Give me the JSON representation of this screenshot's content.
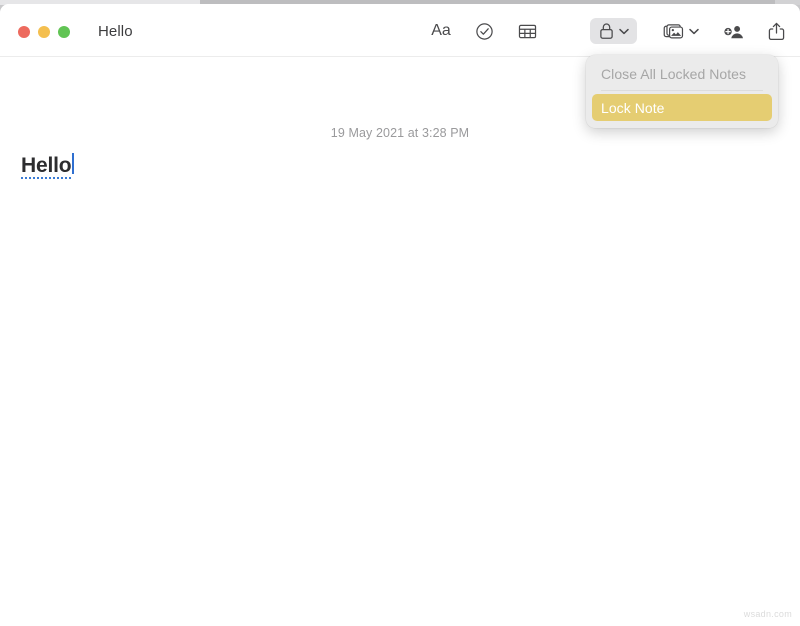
{
  "window": {
    "title": "Hello",
    "traffic_lights": [
      {
        "name": "close",
        "color": "#ed6a5e"
      },
      {
        "name": "minimize",
        "color": "#f4bf4f"
      },
      {
        "name": "maximize",
        "color": "#61c454"
      }
    ]
  },
  "toolbar": {
    "format_label": "Aa",
    "buttons": [
      {
        "icon": "format-aa-icon",
        "label": "Aa"
      },
      {
        "icon": "checklist-icon",
        "label": "Checklist"
      },
      {
        "icon": "table-icon",
        "label": "Table"
      },
      {
        "icon": "lock-icon",
        "label": "Lock"
      },
      {
        "icon": "media-icon",
        "label": "Media"
      },
      {
        "icon": "add-person-icon",
        "label": "Add People"
      },
      {
        "icon": "share-icon",
        "label": "Share"
      }
    ]
  },
  "note": {
    "date": "19 May 2021 at 3:28 PM",
    "text": "Hello"
  },
  "lock_menu": {
    "items": [
      {
        "label": "Close All Locked Notes",
        "state": "disabled"
      },
      {
        "label": "Lock Note",
        "state": "highlighted"
      }
    ]
  },
  "watermark": "wsadn.com",
  "colors": {
    "menu_highlight": "#e5cd72",
    "toolbar_active": "#e3e3e5",
    "spellcheck_underline": "#3a7bd5",
    "caret": "#2f6fd0",
    "date_text": "#9a9a9c"
  }
}
